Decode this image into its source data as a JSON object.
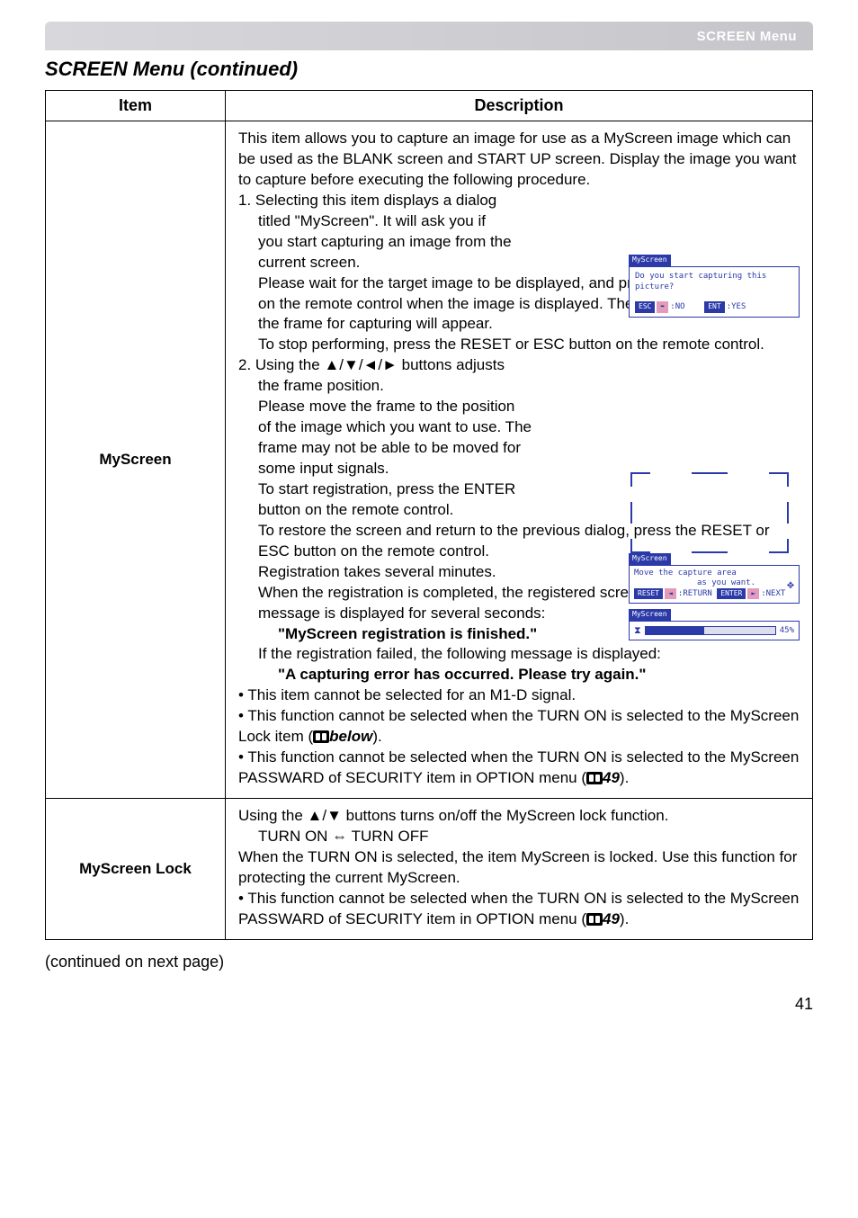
{
  "header": {
    "title": "SCREEN Menu"
  },
  "sectionTitle": "SCREEN Menu (continued)",
  "tableHead": {
    "item": "Item",
    "desc": "Description"
  },
  "rows": {
    "myscreen": {
      "item": "MyScreen",
      "p1": "This item allows you to capture an image for use as a MyScreen image which can be used as the BLANK screen and START UP screen. Display the image you want to capture before executing the following procedure.",
      "s1a": "1. Selecting this item displays a dialog",
      "s1b": "titled \"MyScreen\". It will ask you if",
      "s1c": "you start capturing an image from the",
      "s1d": "current screen.",
      "s1e": "Please wait for the target image to be displayed, and press the ENTER button on the remote control when the image is displayed. The image will freeze and the frame for capturing will appear.",
      "s1f": "To stop performing, press the RESET or ESC button on the remote control.",
      "s2a": "2. Using the ▲/▼/◄/► buttons adjusts",
      "s2b": "the frame position.",
      "s2c": "Please move the frame to the position",
      "s2d": "of the image which you want to use. The",
      "s2e": "frame may not be able to be moved for",
      "s2f": "some input signals.",
      "s2g": "To start registration, press the ENTER",
      "s2h": "button on the remote control.",
      "s2i": "To restore the screen and return to the previous dialog, press the RESET or ESC button on the remote control.",
      "s2j": "Registration takes several minutes.",
      "s2k": "When the registration is completed, the registered screen and the following message is displayed for several seconds:",
      "msg1": "\"MyScreen registration is finished.\"",
      "s2l": "If the registration failed, the following message is displayed:",
      "msg2": "\"A capturing error has occurred. Please try again.\"",
      "b1": "• This item cannot be selected for an M1-D signal.",
      "b2a": "• This function cannot be selected when the TURN ON is selected to the MyScreen Lock item (",
      "b2b": "below",
      "b2c": ").",
      "b3a": "• This function cannot be selected when the TURN ON is selected to the MyScreen PASSWARD of SECURITY item in OPTION menu (",
      "b3b": "49",
      "b3c": ")."
    },
    "lock": {
      "item": "MyScreen Lock",
      "l1": "Using the ▲/▼ buttons turns on/off the MyScreen lock function.",
      "l2": "TURN ON ⇔ TURN OFF",
      "l3": "When the TURN ON is selected, the item MyScreen is locked. Use this function for protecting the current MyScreen.",
      "l4a": "• This function cannot be selected when the TURN ON is selected to the MyScreen PASSWARD of SECURITY item in OPTION menu (",
      "l4b": "49",
      "l4c": ")."
    }
  },
  "dialogs": {
    "d1": {
      "title": "MyScreen",
      "line": "Do you start capturing this picture?",
      "esc": "ESC",
      "no": ":NO",
      "ent": "ENT",
      "yes": ":YES",
      "arrow": "➨"
    },
    "d2": {
      "title": "MyScreen",
      "l1": "Move the capture area",
      "l2": "as you want.",
      "reset": "RESET",
      "left": "◄",
      "ret": ":RETURN",
      "enter": "ENTER",
      "right": "►",
      "next": ":NEXT"
    },
    "d3": {
      "title": "MyScreen",
      "pct": "45%"
    }
  },
  "cont": "(continued on next page)",
  "pageNumber": "41"
}
